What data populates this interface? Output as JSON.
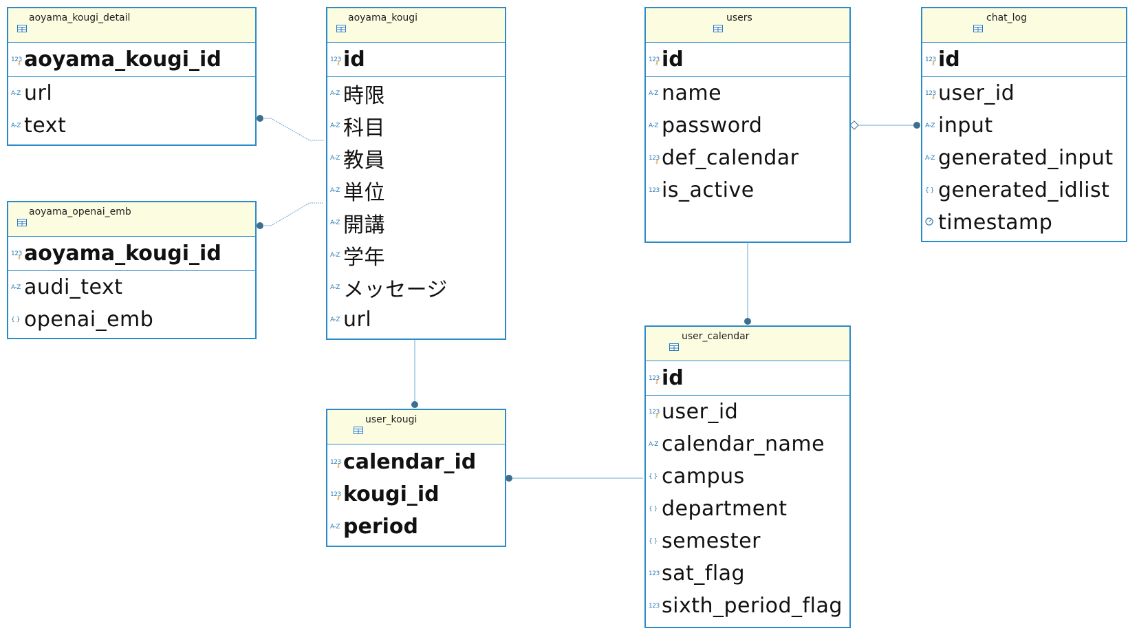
{
  "entities": {
    "aoyama_kougi_detail": {
      "title": "aoyama_kougi_detail",
      "pk": [
        {
          "name": "aoyama_kougi_id",
          "type": "123"
        }
      ],
      "columns": [
        {
          "name": "url",
          "type": "A-Z"
        },
        {
          "name": "text",
          "type": "A-Z"
        }
      ]
    },
    "aoyama_openai_emb": {
      "title": "aoyama_openai_emb",
      "pk": [
        {
          "name": "aoyama_kougi_id",
          "type": "123"
        }
      ],
      "columns": [
        {
          "name": "audi_text",
          "type": "A-Z"
        },
        {
          "name": "openai_emb",
          "type": "{}"
        }
      ]
    },
    "aoyama_kougi": {
      "title": "aoyama_kougi",
      "pk": [
        {
          "name": "id",
          "type": "123"
        }
      ],
      "columns": [
        {
          "name": "時限",
          "type": "A-Z"
        },
        {
          "name": "科目",
          "type": "A-Z"
        },
        {
          "name": "教員",
          "type": "A-Z"
        },
        {
          "name": "単位",
          "type": "A-Z"
        },
        {
          "name": "開講",
          "type": "A-Z"
        },
        {
          "name": "学年",
          "type": "A-Z"
        },
        {
          "name": "メッセージ",
          "type": "A-Z"
        },
        {
          "name": "url",
          "type": "A-Z"
        }
      ]
    },
    "user_kougi": {
      "title": "user_kougi",
      "pk": [],
      "columns": [
        {
          "name": "calendar_id",
          "type": "123",
          "bold": true
        },
        {
          "name": "kougi_id",
          "type": "123",
          "bold": true
        },
        {
          "name": "period",
          "type": "A-Z",
          "bold": true
        }
      ]
    },
    "users": {
      "title": "users",
      "pk": [
        {
          "name": "id",
          "type": "123"
        }
      ],
      "columns": [
        {
          "name": "name",
          "type": "A-Z"
        },
        {
          "name": "password",
          "type": "A-Z"
        },
        {
          "name": "def_calendar",
          "type": "123"
        },
        {
          "name": "is_active",
          "type": "123"
        }
      ]
    },
    "chat_log": {
      "title": "chat_log",
      "pk": [
        {
          "name": "id",
          "type": "123"
        }
      ],
      "columns": [
        {
          "name": "user_id",
          "type": "123"
        },
        {
          "name": "input",
          "type": "A-Z"
        },
        {
          "name": "generated_input",
          "type": "A-Z"
        },
        {
          "name": "generated_idlist",
          "type": "{}"
        },
        {
          "name": "timestamp",
          "type": "clock"
        }
      ]
    },
    "user_calendar": {
      "title": "user_calendar",
      "pk": [
        {
          "name": "id",
          "type": "123"
        }
      ],
      "columns": [
        {
          "name": "user_id",
          "type": "123"
        },
        {
          "name": "calendar_name",
          "type": "A-Z"
        },
        {
          "name": "campus",
          "type": "{}"
        },
        {
          "name": "department",
          "type": "{}"
        },
        {
          "name": "semester",
          "type": "{}"
        },
        {
          "name": "sat_flag",
          "type": "123"
        },
        {
          "name": "sixth_period_flag",
          "type": "123"
        }
      ]
    }
  },
  "relationships": [
    {
      "from": "aoyama_kougi_detail",
      "to": "aoyama_kougi"
    },
    {
      "from": "aoyama_openai_emb",
      "to": "aoyama_kougi"
    },
    {
      "from": "user_kougi",
      "to": "aoyama_kougi"
    },
    {
      "from": "user_kougi",
      "to": "user_calendar"
    },
    {
      "from": "user_calendar",
      "to": "users"
    },
    {
      "from": "chat_log",
      "to": "users"
    }
  ],
  "colors": {
    "border": "#2a8bc6",
    "header_bg": "#fcfce0",
    "edge": "#6aaad0",
    "dot": "#3d6f8f",
    "type_icon": "#2a7ab8",
    "key_icon": "#d88a1a"
  }
}
